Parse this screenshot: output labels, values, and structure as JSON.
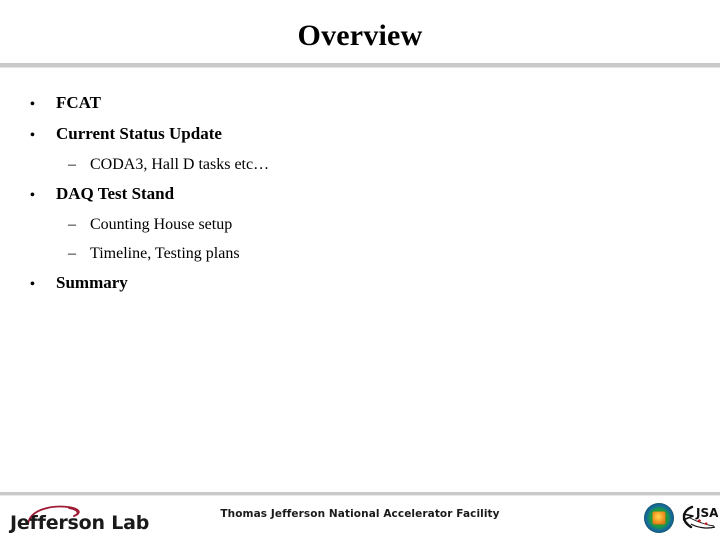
{
  "slide": {
    "title": "Overview",
    "bullets": [
      {
        "level": 1,
        "marker": "•",
        "text": "FCAT"
      },
      {
        "level": 1,
        "marker": "•",
        "text": "Current Status Update"
      },
      {
        "level": 2,
        "marker": "–",
        "text": "CODA3, Hall D tasks etc…"
      },
      {
        "level": 1,
        "marker": "•",
        "text": "DAQ Test Stand"
      },
      {
        "level": 2,
        "marker": "–",
        "text": "Counting House setup"
      },
      {
        "level": 2,
        "marker": "–",
        "text": "Timeline, Testing plans"
      },
      {
        "level": 1,
        "marker": "•",
        "text": "Summary"
      }
    ]
  },
  "footer": {
    "organization_wordmark": "Jefferson Lab",
    "center_text": "Thomas Jefferson National Accelerator Facility",
    "jsa_text": "JSA",
    "icons": {
      "doe_seal": "doe-seal-icon",
      "jsa_logo": "jsa-logo-icon",
      "jlab_swoosh": "jlab-swoosh-icon"
    }
  },
  "colors": {
    "divider": "#c9c9c9",
    "text": "#000000",
    "jlab_crimson": "#9e1b34",
    "jsa_red": "#c4161c",
    "background": "#ffffff"
  }
}
